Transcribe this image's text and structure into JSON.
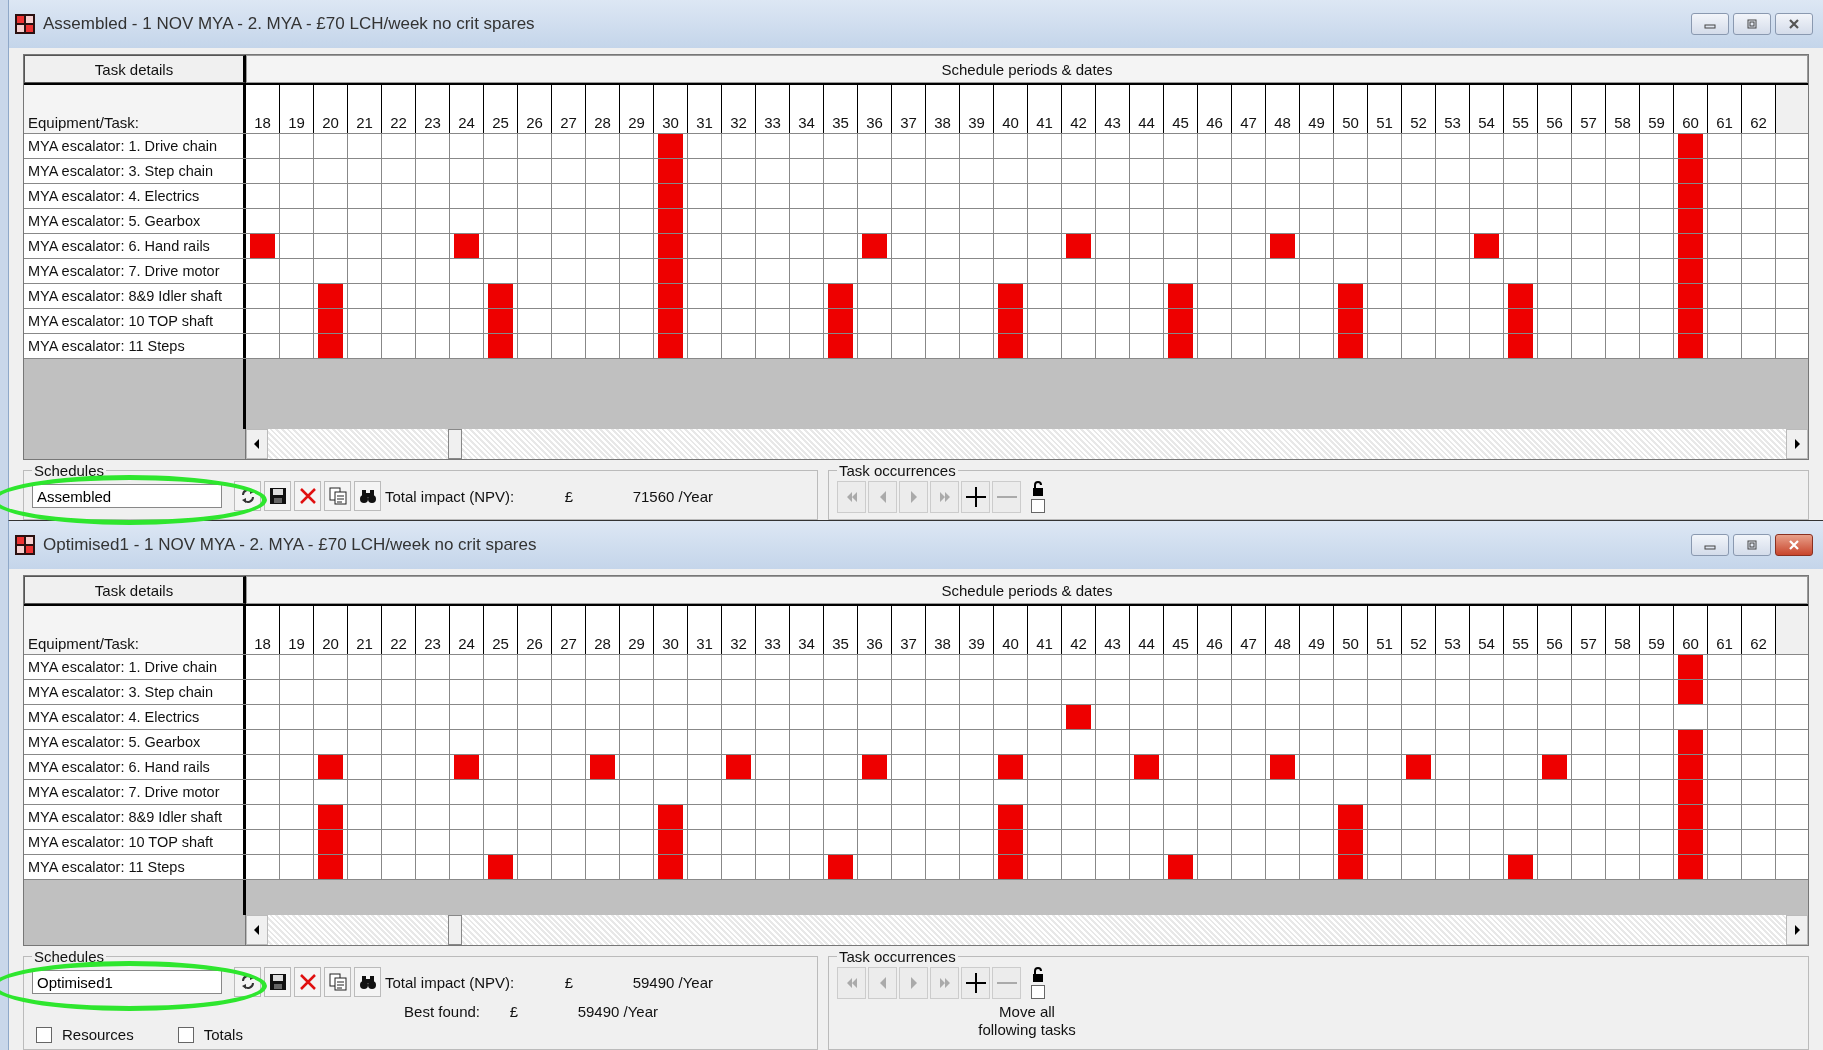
{
  "windows": [
    {
      "title": "Assembled - 1 NOV MYA - 2. MYA - £70 LCH/week no crit spares",
      "active": false,
      "grid": {
        "left_header": "Task details",
        "right_header": "Schedule periods & dates",
        "task_column": "Equipment/Task:",
        "periods": [
          "18",
          "19",
          "20",
          "21",
          "22",
          "23",
          "24",
          "25",
          "26",
          "27",
          "28",
          "29",
          "30",
          "31",
          "32",
          "33",
          "34",
          "35",
          "36",
          "37",
          "38",
          "39",
          "40",
          "41",
          "42",
          "43",
          "44",
          "45",
          "46",
          "47",
          "48",
          "49",
          "50",
          "51",
          "52",
          "53",
          "54",
          "55",
          "56",
          "57",
          "58",
          "59",
          "60",
          "61",
          "62"
        ],
        "rows": [
          {
            "task": "MYA escalator: 1. Drive chain",
            "scheduled": [
              false,
              false,
              false,
              false,
              false,
              false,
              false,
              false,
              false,
              false,
              false,
              false,
              true,
              false,
              false,
              false,
              false,
              false,
              false,
              false,
              false,
              false,
              false,
              false,
              false,
              false,
              false,
              false,
              false,
              false,
              false,
              false,
              false,
              false,
              false,
              false,
              false,
              false,
              false,
              false,
              false,
              false,
              true,
              false,
              false
            ]
          },
          {
            "task": "MYA escalator: 3. Step chain",
            "scheduled": [
              false,
              false,
              false,
              false,
              false,
              false,
              false,
              false,
              false,
              false,
              false,
              false,
              true,
              false,
              false,
              false,
              false,
              false,
              false,
              false,
              false,
              false,
              false,
              false,
              false,
              false,
              false,
              false,
              false,
              false,
              false,
              false,
              false,
              false,
              false,
              false,
              false,
              false,
              false,
              false,
              false,
              false,
              true,
              false,
              false
            ]
          },
          {
            "task": "MYA escalator: 4. Electrics",
            "scheduled": [
              false,
              false,
              false,
              false,
              false,
              false,
              false,
              false,
              false,
              false,
              false,
              false,
              true,
              false,
              false,
              false,
              false,
              false,
              false,
              false,
              false,
              false,
              false,
              false,
              false,
              false,
              false,
              false,
              false,
              false,
              false,
              false,
              false,
              false,
              false,
              false,
              false,
              false,
              false,
              false,
              false,
              false,
              true,
              false,
              false
            ]
          },
          {
            "task": "MYA escalator: 5. Gearbox",
            "scheduled": [
              false,
              false,
              false,
              false,
              false,
              false,
              false,
              false,
              false,
              false,
              false,
              false,
              true,
              false,
              false,
              false,
              false,
              false,
              false,
              false,
              false,
              false,
              false,
              false,
              false,
              false,
              false,
              false,
              false,
              false,
              false,
              false,
              false,
              false,
              false,
              false,
              false,
              false,
              false,
              false,
              false,
              false,
              true,
              false,
              false
            ]
          },
          {
            "task": "MYA escalator: 6. Hand rails",
            "scheduled": [
              true,
              false,
              false,
              false,
              false,
              false,
              true,
              false,
              false,
              false,
              false,
              false,
              true,
              false,
              false,
              false,
              false,
              false,
              true,
              false,
              false,
              false,
              false,
              false,
              true,
              false,
              false,
              false,
              false,
              false,
              true,
              false,
              false,
              false,
              false,
              false,
              true,
              false,
              false,
              false,
              false,
              false,
              true,
              false,
              false
            ]
          },
          {
            "task": "MYA escalator: 7. Drive motor",
            "scheduled": [
              false,
              false,
              false,
              false,
              false,
              false,
              false,
              false,
              false,
              false,
              false,
              false,
              true,
              false,
              false,
              false,
              false,
              false,
              false,
              false,
              false,
              false,
              false,
              false,
              false,
              false,
              false,
              false,
              false,
              false,
              false,
              false,
              false,
              false,
              false,
              false,
              false,
              false,
              false,
              false,
              false,
              false,
              true,
              false,
              false
            ]
          },
          {
            "task": "MYA escalator: 8&9 Idler shaft",
            "scheduled": [
              false,
              false,
              true,
              false,
              false,
              false,
              false,
              true,
              false,
              false,
              false,
              false,
              true,
              false,
              false,
              false,
              false,
              true,
              false,
              false,
              false,
              false,
              true,
              false,
              false,
              false,
              false,
              true,
              false,
              false,
              false,
              false,
              true,
              false,
              false,
              false,
              false,
              true,
              false,
              false,
              false,
              false,
              true,
              false,
              false
            ]
          },
          {
            "task": "MYA escalator: 10 TOP shaft",
            "scheduled": [
              false,
              false,
              true,
              false,
              false,
              false,
              false,
              true,
              false,
              false,
              false,
              false,
              true,
              false,
              false,
              false,
              false,
              true,
              false,
              false,
              false,
              false,
              true,
              false,
              false,
              false,
              false,
              true,
              false,
              false,
              false,
              false,
              true,
              false,
              false,
              false,
              false,
              true,
              false,
              false,
              false,
              false,
              true,
              false,
              false
            ]
          },
          {
            "task": "MYA escalator: 11 Steps",
            "scheduled": [
              false,
              false,
              true,
              false,
              false,
              false,
              false,
              true,
              false,
              false,
              false,
              false,
              true,
              false,
              false,
              false,
              false,
              true,
              false,
              false,
              false,
              false,
              true,
              false,
              false,
              false,
              false,
              true,
              false,
              false,
              false,
              false,
              true,
              false,
              false,
              false,
              false,
              true,
              false,
              false,
              false,
              false,
              true,
              false,
              false
            ]
          }
        ]
      },
      "schedules": {
        "legend": "Schedules",
        "value": "Assembled",
        "highlighted": true,
        "total_label": "Total impact (NPV):",
        "total_currency": "£",
        "total_value": "71560 /Year"
      },
      "occurrences": {
        "legend": "Task occurrences",
        "lock_checked": false
      }
    },
    {
      "title": "Optimised1 - 1 NOV MYA - 2. MYA - £70 LCH/week no crit spares",
      "active": true,
      "grid": {
        "left_header": "Task details",
        "right_header": "Schedule periods & dates",
        "task_column": "Equipment/Task:",
        "periods": [
          "18",
          "19",
          "20",
          "21",
          "22",
          "23",
          "24",
          "25",
          "26",
          "27",
          "28",
          "29",
          "30",
          "31",
          "32",
          "33",
          "34",
          "35",
          "36",
          "37",
          "38",
          "39",
          "40",
          "41",
          "42",
          "43",
          "44",
          "45",
          "46",
          "47",
          "48",
          "49",
          "50",
          "51",
          "52",
          "53",
          "54",
          "55",
          "56",
          "57",
          "58",
          "59",
          "60",
          "61",
          "62"
        ],
        "rows": [
          {
            "task": "MYA escalator: 1. Drive chain",
            "scheduled": [
              false,
              false,
              false,
              false,
              false,
              false,
              false,
              false,
              false,
              false,
              false,
              false,
              false,
              false,
              false,
              false,
              false,
              false,
              false,
              false,
              false,
              false,
              false,
              false,
              false,
              false,
              false,
              false,
              false,
              false,
              false,
              false,
              false,
              false,
              false,
              false,
              false,
              false,
              false,
              false,
              false,
              false,
              true,
              false,
              false
            ]
          },
          {
            "task": "MYA escalator: 3. Step chain",
            "scheduled": [
              false,
              false,
              false,
              false,
              false,
              false,
              false,
              false,
              false,
              false,
              false,
              false,
              false,
              false,
              false,
              false,
              false,
              false,
              false,
              false,
              false,
              false,
              false,
              false,
              false,
              false,
              false,
              false,
              false,
              false,
              false,
              false,
              false,
              false,
              false,
              false,
              false,
              false,
              false,
              false,
              false,
              false,
              true,
              false,
              false
            ]
          },
          {
            "task": "MYA escalator: 4. Electrics",
            "scheduled": [
              false,
              false,
              false,
              false,
              false,
              false,
              false,
              false,
              false,
              false,
              false,
              false,
              false,
              false,
              false,
              false,
              false,
              false,
              false,
              false,
              false,
              false,
              false,
              false,
              true,
              false,
              false,
              false,
              false,
              false,
              false,
              false,
              false,
              false,
              false,
              false,
              false,
              false,
              false,
              false,
              false,
              false,
              false,
              false,
              false
            ]
          },
          {
            "task": "MYA escalator: 5. Gearbox",
            "scheduled": [
              false,
              false,
              false,
              false,
              false,
              false,
              false,
              false,
              false,
              false,
              false,
              false,
              false,
              false,
              false,
              false,
              false,
              false,
              false,
              false,
              false,
              false,
              false,
              false,
              false,
              false,
              false,
              false,
              false,
              false,
              false,
              false,
              false,
              false,
              false,
              false,
              false,
              false,
              false,
              false,
              false,
              false,
              true,
              false,
              false
            ]
          },
          {
            "task": "MYA escalator: 6. Hand rails",
            "scheduled": [
              false,
              false,
              true,
              false,
              false,
              false,
              true,
              false,
              false,
              false,
              true,
              false,
              false,
              false,
              true,
              false,
              false,
              false,
              true,
              false,
              false,
              false,
              true,
              false,
              false,
              false,
              true,
              false,
              false,
              false,
              true,
              false,
              false,
              false,
              true,
              false,
              false,
              false,
              true,
              false,
              false,
              false,
              true,
              false,
              false
            ]
          },
          {
            "task": "MYA escalator: 7. Drive motor",
            "scheduled": [
              false,
              false,
              false,
              false,
              false,
              false,
              false,
              false,
              false,
              false,
              false,
              false,
              false,
              false,
              false,
              false,
              false,
              false,
              false,
              false,
              false,
              false,
              false,
              false,
              false,
              false,
              false,
              false,
              false,
              false,
              false,
              false,
              false,
              false,
              false,
              false,
              false,
              false,
              false,
              false,
              false,
              false,
              true,
              false,
              false
            ]
          },
          {
            "task": "MYA escalator: 8&9 Idler shaft",
            "scheduled": [
              false,
              false,
              true,
              false,
              false,
              false,
              false,
              false,
              false,
              false,
              false,
              false,
              true,
              false,
              false,
              false,
              false,
              false,
              false,
              false,
              false,
              false,
              true,
              false,
              false,
              false,
              false,
              false,
              false,
              false,
              false,
              false,
              true,
              false,
              false,
              false,
              false,
              false,
              false,
              false,
              false,
              false,
              true,
              false,
              false
            ]
          },
          {
            "task": "MYA escalator: 10 TOP shaft",
            "scheduled": [
              false,
              false,
              true,
              false,
              false,
              false,
              false,
              false,
              false,
              false,
              false,
              false,
              true,
              false,
              false,
              false,
              false,
              false,
              false,
              false,
              false,
              false,
              true,
              false,
              false,
              false,
              false,
              false,
              false,
              false,
              false,
              false,
              true,
              false,
              false,
              false,
              false,
              false,
              false,
              false,
              false,
              false,
              true,
              false,
              false
            ]
          },
          {
            "task": "MYA escalator: 11 Steps",
            "scheduled": [
              false,
              false,
              true,
              false,
              false,
              false,
              false,
              true,
              false,
              false,
              false,
              false,
              true,
              false,
              false,
              false,
              false,
              true,
              false,
              false,
              false,
              false,
              true,
              false,
              false,
              false,
              false,
              true,
              false,
              false,
              false,
              false,
              true,
              false,
              false,
              false,
              false,
              true,
              false,
              false,
              false,
              false,
              true,
              false,
              false
            ]
          }
        ]
      },
      "schedules": {
        "legend": "Schedules",
        "value": "Optimised1",
        "highlighted": true,
        "total_label": "Total impact (NPV):",
        "total_currency": "£",
        "total_value": "59490 /Year",
        "best_label": "Best found:",
        "best_currency": "£",
        "best_value": "59490 /Year",
        "checkboxes": [
          {
            "label": "Resources",
            "checked": false
          },
          {
            "label": "Totals",
            "checked": false
          }
        ]
      },
      "occurrences": {
        "legend": "Task occurrences",
        "lock_checked": false,
        "note": "Move all following tasks"
      }
    }
  ]
}
